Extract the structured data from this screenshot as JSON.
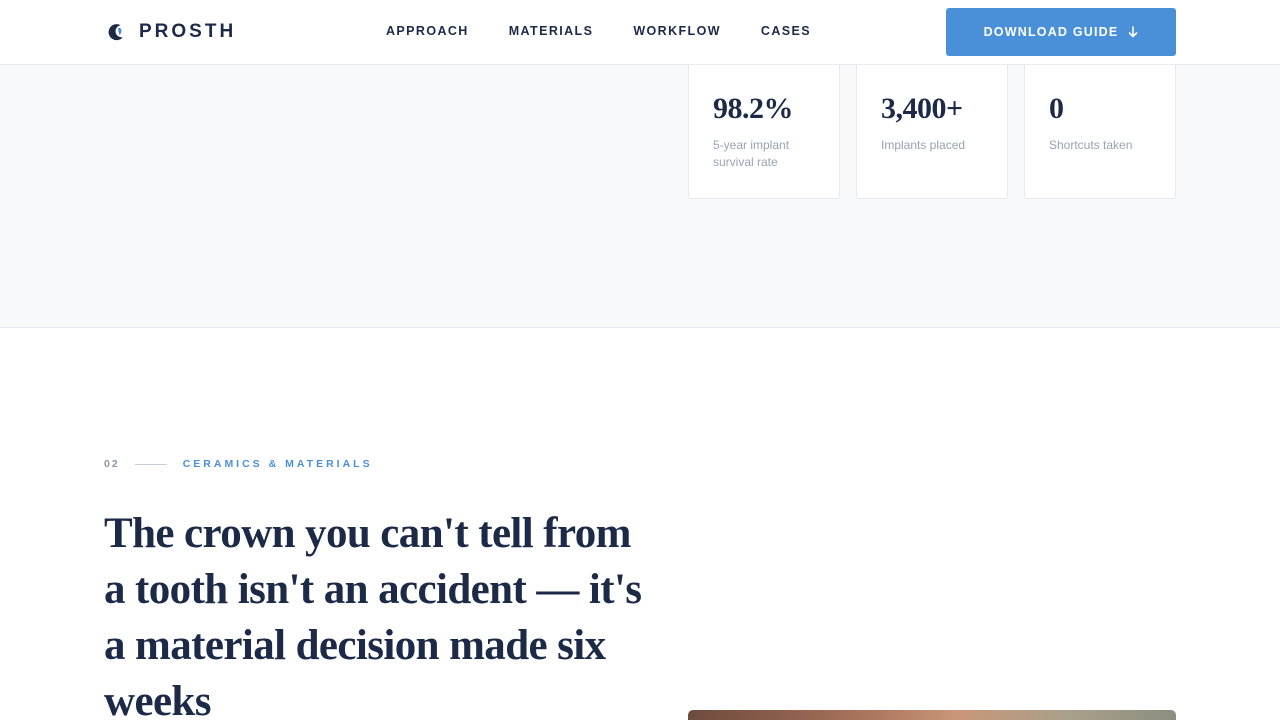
{
  "header": {
    "brand": "PROSTH",
    "logo_icon": "crescent-tooth-icon",
    "nav": [
      "APPROACH",
      "MATERIALS",
      "WORKFLOW",
      "CASES"
    ],
    "cta_label": "DOWNLOAD GUIDE",
    "cta_icon": "arrow-down-icon",
    "accent_color": "#4a90d9",
    "text_color": "#1c2a48"
  },
  "stats": [
    {
      "value": "98.2%",
      "label": "5-year implant survival rate"
    },
    {
      "value": "3,400+",
      "label": "Implants placed"
    },
    {
      "value": "0",
      "label": "Shortcuts taken"
    }
  ],
  "section": {
    "number": "02",
    "label": "CERAMICS & MATERIALS",
    "headline": "The crown you can't tell from a tooth isn't an accident — it's a material decision made six weeks"
  }
}
